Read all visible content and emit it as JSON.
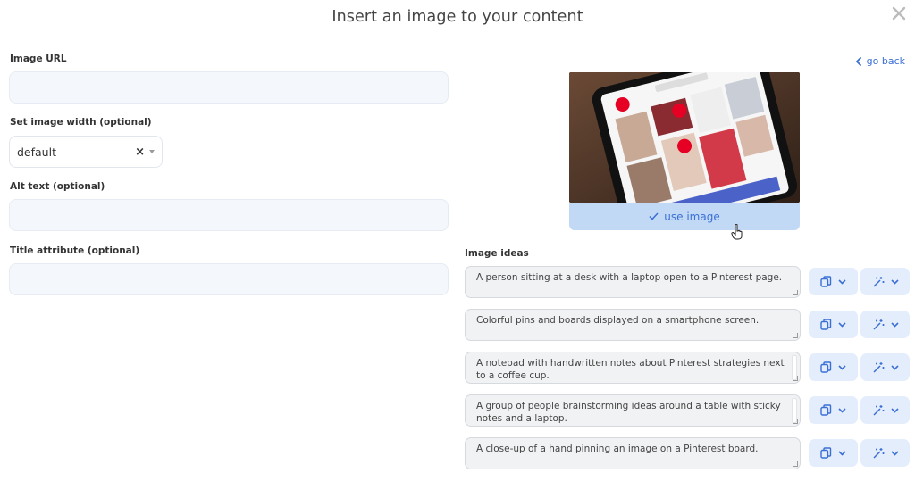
{
  "dialog": {
    "title": "Insert an image to your content",
    "close_icon": "close-icon"
  },
  "form": {
    "image_url": {
      "label": "Image URL",
      "value": "",
      "placeholder": ""
    },
    "image_width": {
      "label": "Set image width (optional)",
      "selected": "default",
      "clear_glyph": "×"
    },
    "alt_text": {
      "label": "Alt text (optional)",
      "value": "",
      "placeholder": ""
    },
    "title_attr": {
      "label": "Title attribute (optional)",
      "value": "",
      "placeholder": ""
    }
  },
  "preview": {
    "go_back_label": "go back",
    "use_image_label": "use image"
  },
  "ideas": {
    "label": "Image ideas",
    "items": [
      {
        "text": "A person sitting at a desk with a laptop open to a Pinterest page."
      },
      {
        "text": "Colorful pins and boards displayed on a smartphone screen."
      },
      {
        "text": "A notepad with handwritten notes about Pinterest strategies next to a coffee cup."
      },
      {
        "text": "A group of people brainstorming ideas around a table with sticky notes and a laptop."
      },
      {
        "text": "A close-up of a hand pinning an image on a Pinterest board."
      }
    ]
  },
  "colors": {
    "accent": "#3b6fd6",
    "button_bg": "#e3edfc",
    "input_bg": "#f4f7fc",
    "use_image_bg": "#c2d9f6"
  }
}
